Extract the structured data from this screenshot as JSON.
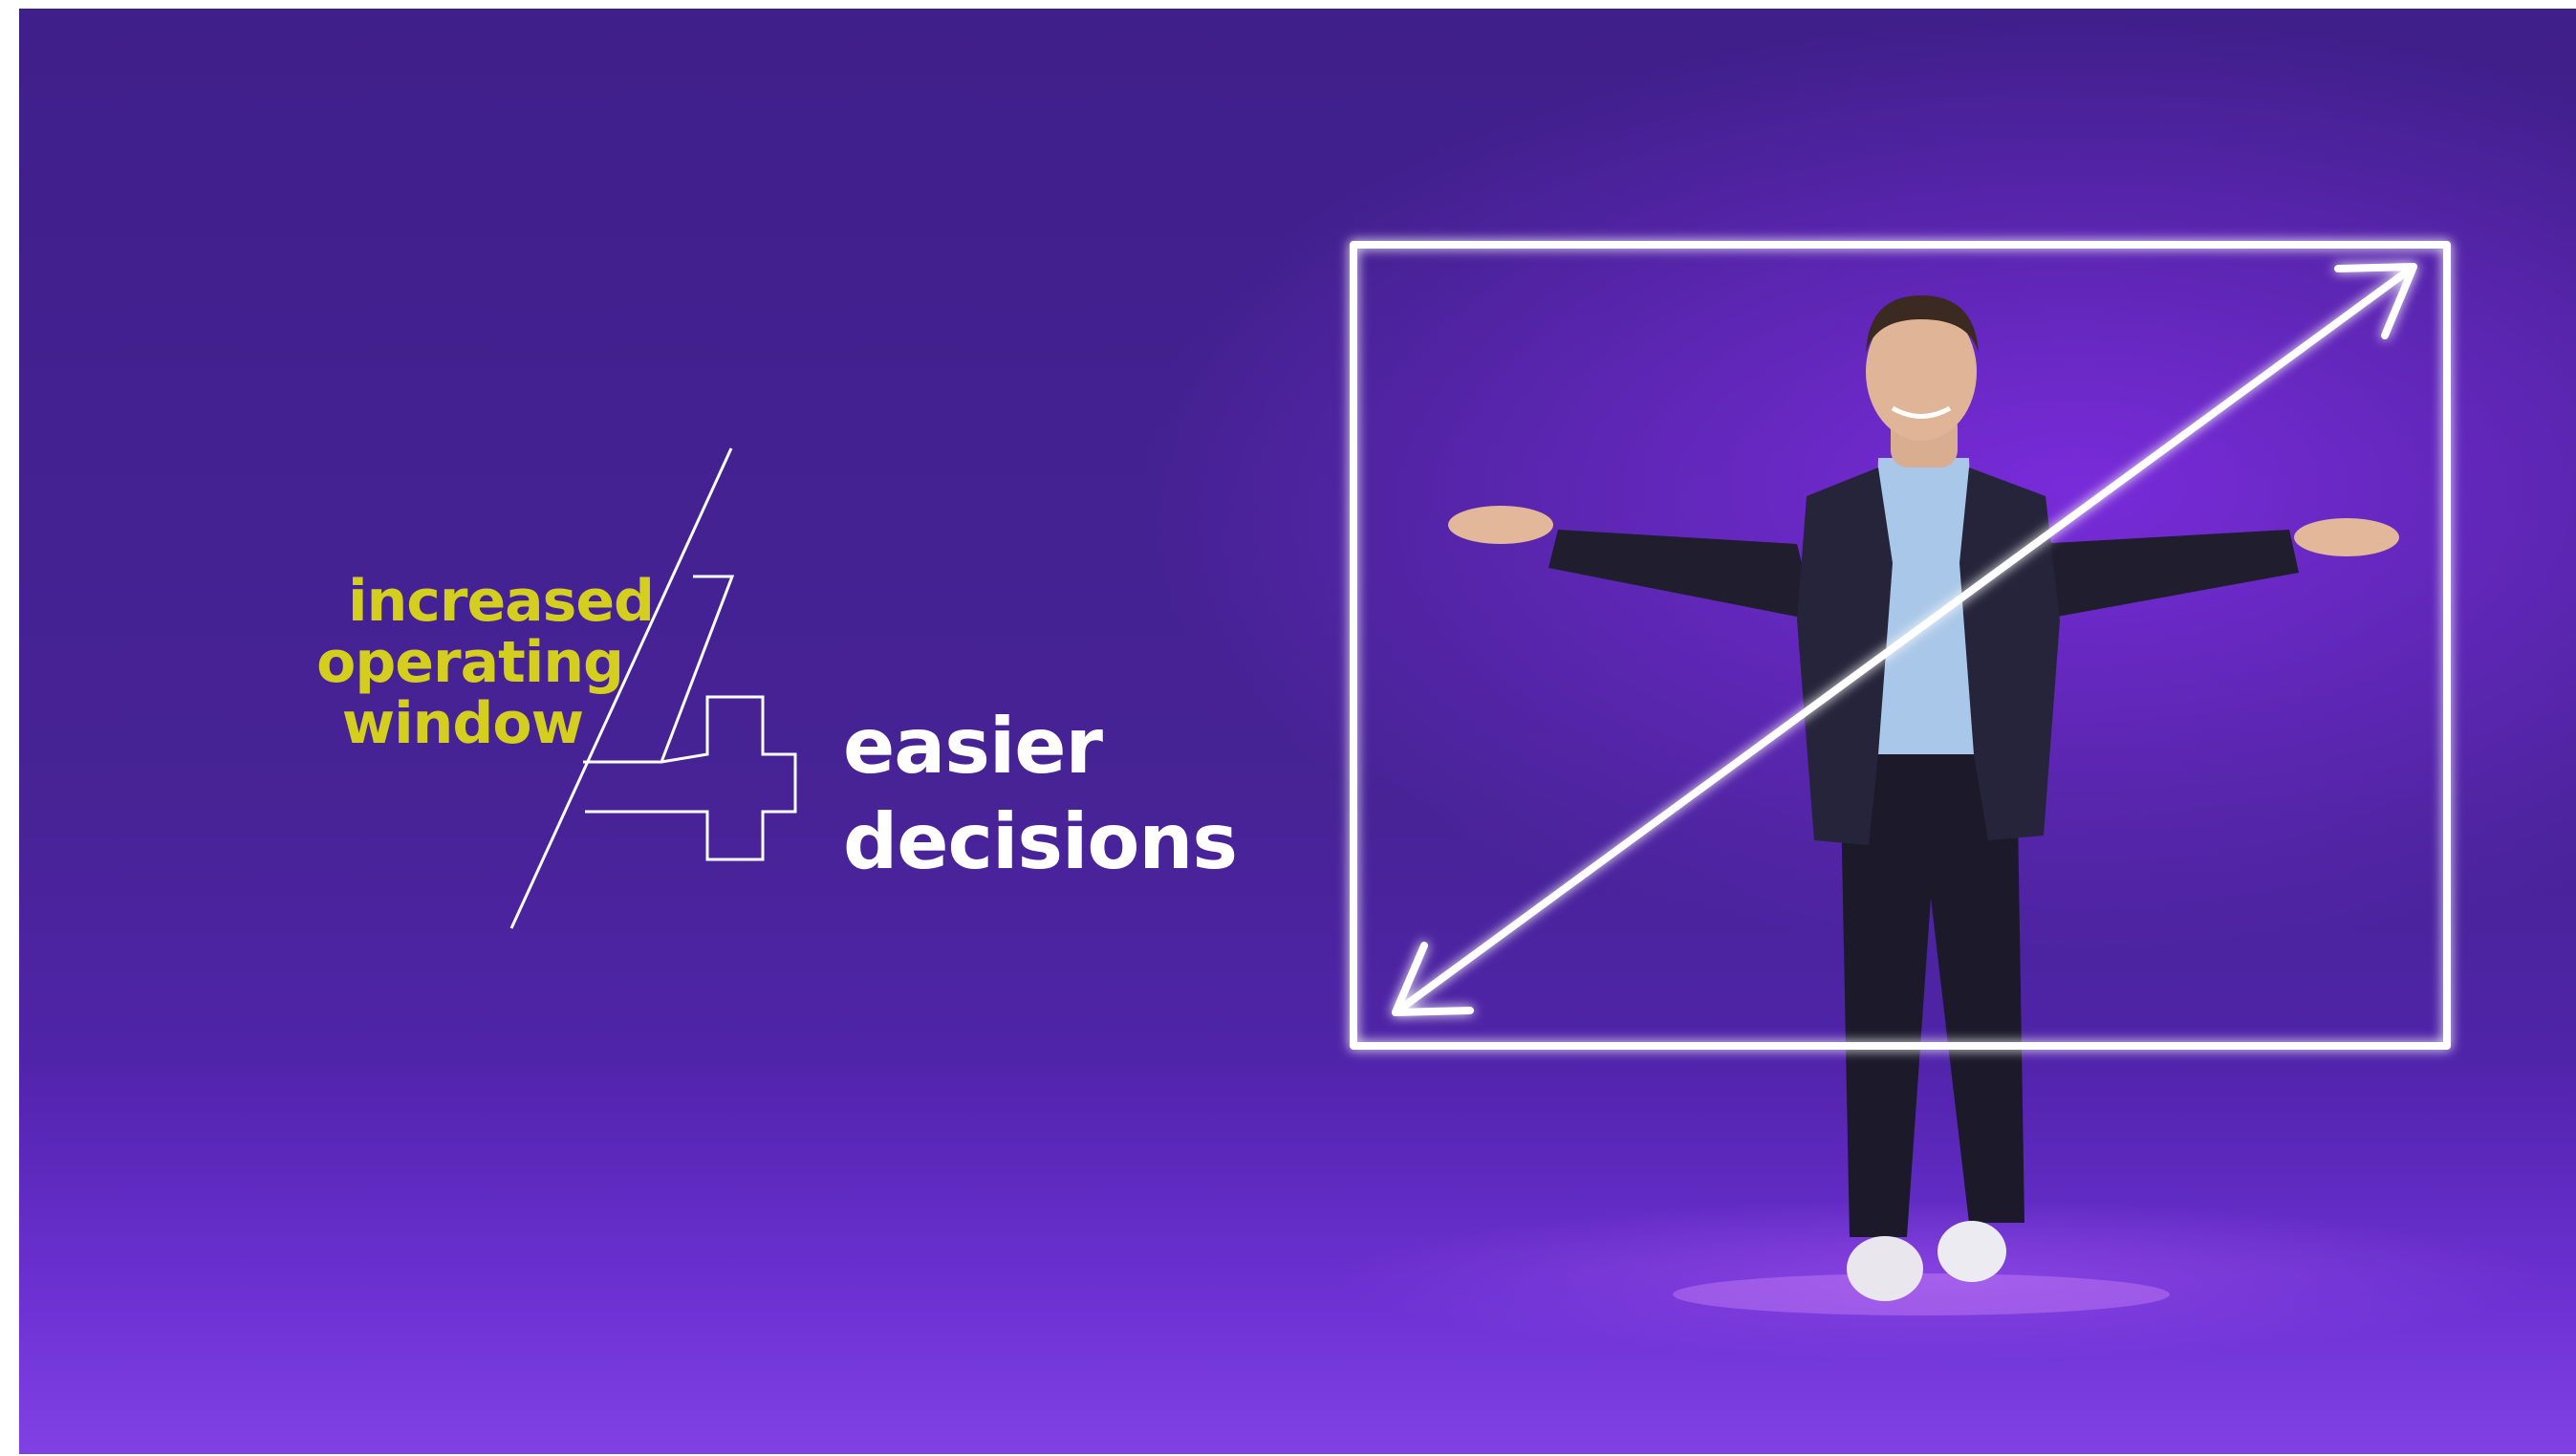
{
  "headline": {
    "left_lines": [
      "increased",
      "operating",
      "window"
    ],
    "right_lines": [
      "easier",
      "decisions"
    ]
  },
  "colors": {
    "left_text": "#d4cf1f",
    "right_text": "#ffffff",
    "background": "#4a2398",
    "frame_line": "#ffffff"
  }
}
